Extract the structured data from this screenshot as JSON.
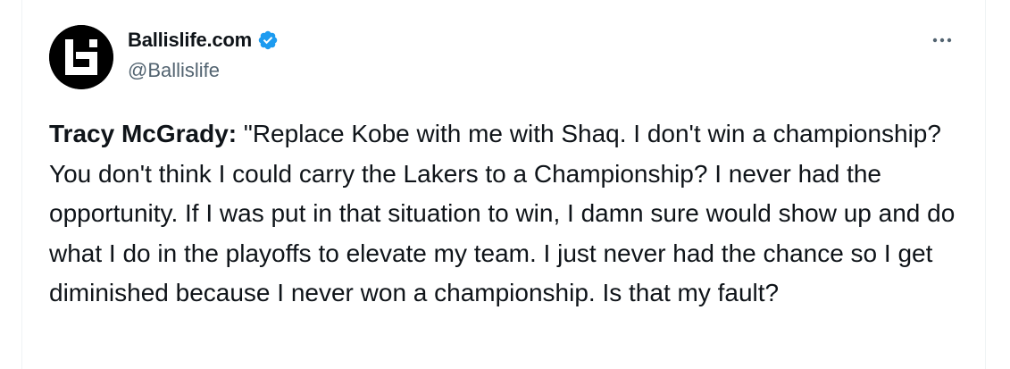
{
  "author": {
    "display_name": "Ballislife.com",
    "handle": "@Ballislife",
    "verified": true,
    "avatar_icon": "ballislife-logo-icon",
    "verified_icon": "verified-badge-icon",
    "verified_color": "#1d9bf0"
  },
  "actions": {
    "more_icon": "more-horizontal-icon"
  },
  "tweet": {
    "speaker": "Tracy McGrady:",
    "body": " \"Replace Kobe with me with Shaq. I don't win a championship? You don't think I could carry the Lakers to a Championship? I never had the opportunity. If I was put in that situation to win, I damn sure would show up and do what I do in the playoffs to elevate my team. I just never had the chance so I get diminished because I never won a championship. Is that my fault?"
  },
  "colors": {
    "text_primary": "#0f1419",
    "text_secondary": "#536471",
    "background": "#ffffff",
    "border": "#eff3f4"
  }
}
